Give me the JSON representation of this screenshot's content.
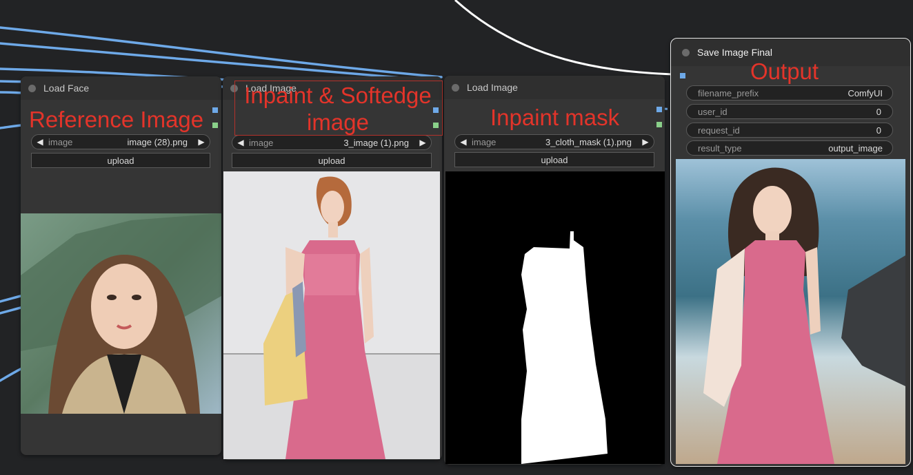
{
  "nodes": {
    "load_face": {
      "title": "Load Face",
      "annotation": "Reference Image",
      "image_widget": {
        "label": "image",
        "value": "image (28).png"
      },
      "upload_label": "upload"
    },
    "load_image_person": {
      "title": "Load Image",
      "annotation_line1": "Inpaint & Softedge",
      "annotation_line2": "image",
      "image_widget": {
        "label": "image",
        "value": "3_image (1).png"
      },
      "upload_label": "upload"
    },
    "load_image_mask": {
      "title": "Load Image",
      "annotation": "Inpaint mask",
      "image_widget": {
        "label": "image",
        "value": "3_cloth_mask (1).png"
      },
      "upload_label": "upload"
    },
    "save_image": {
      "title": "Save Image Final",
      "annotation": "Output",
      "fields": [
        {
          "label": "filename_prefix",
          "value": "ComfyUI"
        },
        {
          "label": "user_id",
          "value": "0"
        },
        {
          "label": "request_id",
          "value": "0"
        },
        {
          "label": "result_type",
          "value": "output_image"
        }
      ]
    }
  },
  "colors": {
    "canvas": "#222325",
    "node_body": "#353535",
    "wire_image": "#6ea9e8",
    "wire_white": "#ffffff",
    "annotation": "#e3342a",
    "slot_blue": "#6ea9e8",
    "slot_green": "#8ad08a"
  },
  "icons": {
    "prev": "◀",
    "next": "▶"
  }
}
